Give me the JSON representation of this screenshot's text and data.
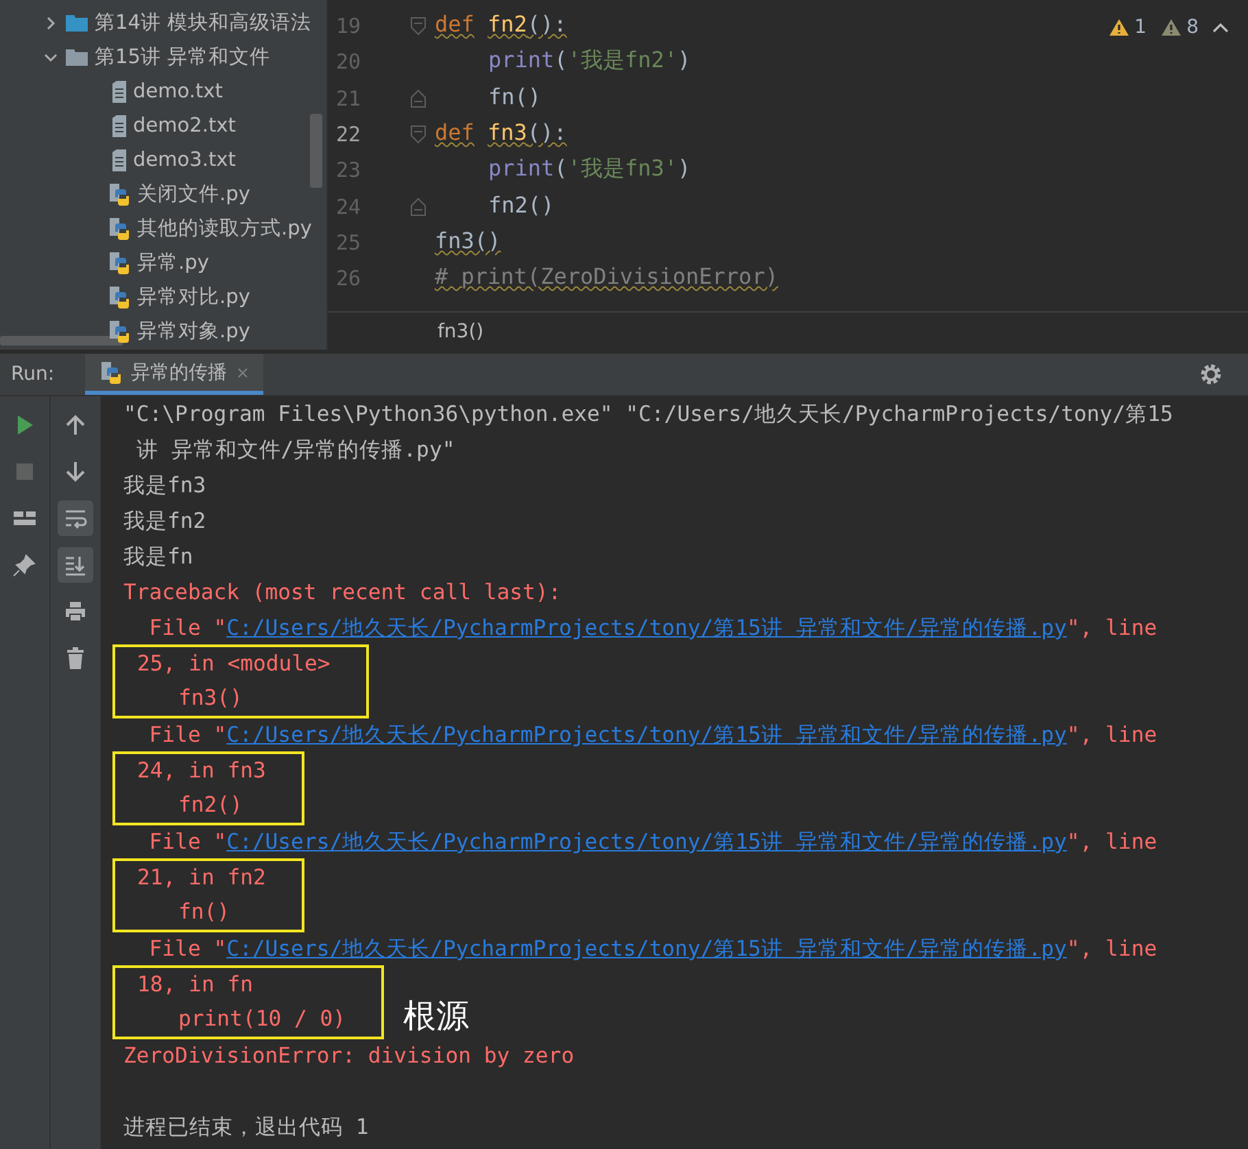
{
  "project_tree": [
    {
      "kind": "folder",
      "label": "第14讲 模块和高级语法",
      "expanded": false,
      "color": "#3592c4"
    },
    {
      "kind": "folder",
      "label": "第15讲 异常和文件",
      "expanded": true,
      "color": "#8c9aa6",
      "children": [
        {
          "kind": "text",
          "label": "demo.txt"
        },
        {
          "kind": "text",
          "label": "demo2.txt"
        },
        {
          "kind": "text",
          "label": "demo3.txt"
        },
        {
          "kind": "python",
          "label": "关闭文件.py"
        },
        {
          "kind": "python",
          "label": "其他的读取方式.py"
        },
        {
          "kind": "python",
          "label": "异常.py"
        },
        {
          "kind": "python",
          "label": "异常对比.py"
        },
        {
          "kind": "python",
          "label": "异常对象.py"
        }
      ]
    }
  ],
  "editor": {
    "lines": [
      {
        "number": "19",
        "current": false,
        "indented": false,
        "warning": true,
        "fold_start": true,
        "fold_end": false,
        "tokens": [
          {
            "kind": "keyword",
            "text": "def"
          },
          {
            "kind": "function",
            "text": "fn2"
          },
          {
            "kind": "plain",
            "text": "():"
          }
        ]
      },
      {
        "number": "20",
        "current": false,
        "indented": true,
        "warning": false,
        "fold_start": false,
        "fold_end": false,
        "tokens": [
          {
            "kind": "builtin",
            "text": "print"
          },
          {
            "kind": "plain",
            "text": "("
          },
          {
            "kind": "string",
            "text": "'我是fn2'"
          },
          {
            "kind": "plain",
            "text": ")"
          }
        ]
      },
      {
        "number": "21",
        "current": false,
        "indented": true,
        "warning": false,
        "fold_start": false,
        "fold_end": true,
        "tokens": [
          {
            "kind": "plain",
            "text": "fn()"
          }
        ]
      },
      {
        "number": "22",
        "current": true,
        "indented": false,
        "warning": true,
        "fold_start": true,
        "fold_end": false,
        "tokens": [
          {
            "kind": "keyword",
            "text": "def"
          },
          {
            "kind": "function",
            "text": "fn3"
          },
          {
            "kind": "plain",
            "text": "():"
          }
        ]
      },
      {
        "number": "23",
        "current": false,
        "indented": true,
        "warning": false,
        "fold_start": false,
        "fold_end": false,
        "tokens": [
          {
            "kind": "builtin",
            "text": "print"
          },
          {
            "kind": "plain",
            "text": "("
          },
          {
            "kind": "string",
            "text": "'我是fn3'"
          },
          {
            "kind": "plain",
            "text": ")"
          }
        ]
      },
      {
        "number": "24",
        "current": false,
        "indented": true,
        "warning": false,
        "fold_start": false,
        "fold_end": true,
        "tokens": [
          {
            "kind": "plain",
            "text": "fn2()"
          }
        ]
      },
      {
        "number": "25",
        "current": false,
        "indented": false,
        "warning": true,
        "fold_start": false,
        "fold_end": false,
        "tokens": [
          {
            "kind": "plain",
            "text": "fn3()"
          }
        ]
      },
      {
        "number": "26",
        "current": false,
        "indented": false,
        "warning": true,
        "fold_start": false,
        "fold_end": false,
        "tokens": [
          {
            "kind": "comment",
            "text": "# print(ZeroDivisionError)"
          }
        ]
      }
    ],
    "inspections": [
      {
        "kind": "warning",
        "count": "1"
      },
      {
        "kind": "weak",
        "count": "8"
      }
    ],
    "breadcrumb": "fn3()"
  },
  "run": {
    "label": "Run:",
    "tabs": [
      {
        "title": "异常的传播",
        "selected": true
      }
    ]
  },
  "console": {
    "blocks": [
      {
        "kind": "output",
        "text": "\"C:\\Program Files\\Python36\\python.exe\" \"C:/Users/地久天长/PycharmProjects/tony/第15"
      },
      {
        "kind": "output",
        "text": " 讲 异常和文件/异常的传播.py\""
      },
      {
        "kind": "output",
        "text": "我是fn3"
      },
      {
        "kind": "output",
        "text": "我是fn2"
      },
      {
        "kind": "output",
        "text": "我是fn"
      },
      {
        "kind": "error",
        "text": "Traceback (most recent call last):"
      },
      {
        "kind": "file",
        "prefix": "  File \"",
        "link": "C:/Users/地久天长/PycharmProjects/tony/第15讲 异常和文件/异常的传播.py",
        "suffix": "\", line"
      },
      {
        "kind": "frame",
        "location": "25, in <module>",
        "code": "fn3()"
      },
      {
        "kind": "file",
        "prefix": "  File \"",
        "link": "C:/Users/地久天长/PycharmProjects/tony/第15讲 异常和文件/异常的传播.py",
        "suffix": "\", line"
      },
      {
        "kind": "frame",
        "location": "24, in fn3",
        "code": "fn2()"
      },
      {
        "kind": "file",
        "prefix": "  File \"",
        "link": "C:/Users/地久天长/PycharmProjects/tony/第15讲 异常和文件/异常的传播.py",
        "suffix": "\", line"
      },
      {
        "kind": "frame",
        "location": "21, in fn2",
        "code": "fn()"
      },
      {
        "kind": "file",
        "prefix": "  File \"",
        "link": "C:/Users/地久天长/PycharmProjects/tony/第15讲 异常和文件/异常的传播.py",
        "suffix": "\", line"
      },
      {
        "kind": "frame",
        "location": "18, in fn",
        "code": "print(10 / 0)",
        "note": "根源"
      },
      {
        "kind": "error",
        "text": "ZeroDivisionError: division by zero"
      },
      {
        "kind": "blank"
      },
      {
        "kind": "output",
        "text": "进程已结束，退出代码 1"
      }
    ]
  }
}
